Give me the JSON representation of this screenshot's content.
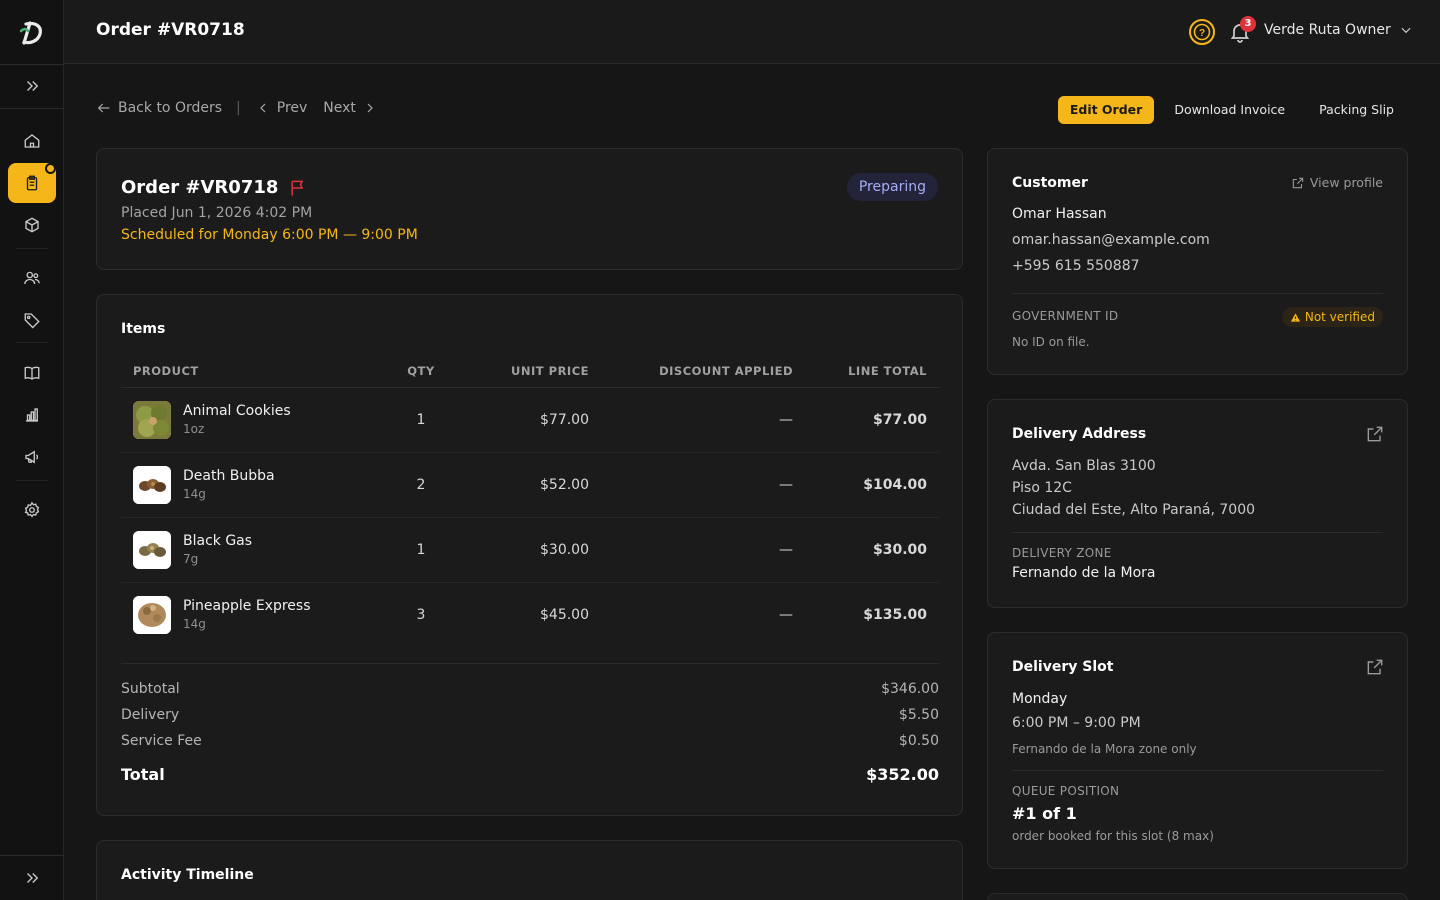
{
  "header": {
    "title": "Order #VR0718",
    "user_name": "Verde Ruta Owner",
    "notification_count": "3"
  },
  "nav": {
    "back_label": "Back to Orders",
    "separator": "|",
    "prev_label": "Prev",
    "next_label": "Next"
  },
  "actions": {
    "edit_order": "Edit Order",
    "download_invoice": "Download Invoice",
    "packing_slip": "Packing Slip"
  },
  "order": {
    "title": "Order #VR0718",
    "placed": "Placed Jun 1, 2026 4:02 PM",
    "scheduled": "Scheduled for Monday 6:00 PM — 9:00 PM",
    "status": "Preparing"
  },
  "items": {
    "title": "Items",
    "columns": [
      "Product",
      "QTY",
      "Unit Price",
      "Discount Applied",
      "Line Total"
    ],
    "rows": [
      {
        "name": "Animal Cookies",
        "size": "1oz",
        "qty": "1",
        "unit_price": "$77.00",
        "discount": "—",
        "line_total": "$77.00"
      },
      {
        "name": "Death Bubba",
        "size": "14g",
        "qty": "2",
        "unit_price": "$52.00",
        "discount": "—",
        "line_total": "$104.00"
      },
      {
        "name": "Black Gas",
        "size": "7g",
        "qty": "1",
        "unit_price": "$30.00",
        "discount": "—",
        "line_total": "$30.00"
      },
      {
        "name": "Pineapple Express",
        "size": "14g",
        "qty": "3",
        "unit_price": "$45.00",
        "discount": "—",
        "line_total": "$135.00"
      }
    ]
  },
  "totals": {
    "subtotal_label": "Subtotal",
    "subtotal": "$346.00",
    "delivery_label": "Delivery",
    "delivery": "$5.50",
    "service_fee_label": "Service Fee",
    "service_fee": "$0.50",
    "total_label": "Total",
    "total": "$352.00"
  },
  "activity": {
    "title": "Activity Timeline"
  },
  "customer": {
    "title": "Customer",
    "view_profile": "View profile",
    "name": "Omar Hassan",
    "email": "omar.hassan@example.com",
    "phone": "+595 615 550887",
    "gov_id_label": "Government ID",
    "gov_id_status": "Not verified",
    "gov_id_note": "No ID on file."
  },
  "delivery_address": {
    "title": "Delivery Address",
    "line1": "Avda. San Blas 3100",
    "line2": "Piso 12C",
    "line3": "Ciudad del Este, Alto Paraná, 7000",
    "zone_label": "Delivery Zone",
    "zone": "Fernando de la Mora"
  },
  "delivery_slot": {
    "title": "Delivery Slot",
    "day": "Monday",
    "time": "6:00 PM – 9:00 PM",
    "note": "Fernando de la Mora zone only",
    "queue_label": "Queue Position",
    "queue": "#1 of 1",
    "queue_note": "order booked for this slot (8 max)"
  },
  "colors": {
    "accent": "#f5b619",
    "background": "#161616",
    "card": "#1b1b1b",
    "status_pill_text": "#a5acf5",
    "danger": "#e0323b"
  },
  "icons": [
    "logo-icon",
    "expand-icon",
    "home-icon",
    "orders-icon",
    "box-icon",
    "users-icon",
    "tag-icon",
    "book-icon",
    "chart-icon",
    "megaphone-icon",
    "gear-icon",
    "help-icon",
    "bell-icon",
    "chevron-down-icon",
    "arrow-left-icon",
    "chevron-left-icon",
    "chevron-right-icon",
    "flag-icon",
    "external-link-icon",
    "warning-icon",
    "edit-icon"
  ]
}
